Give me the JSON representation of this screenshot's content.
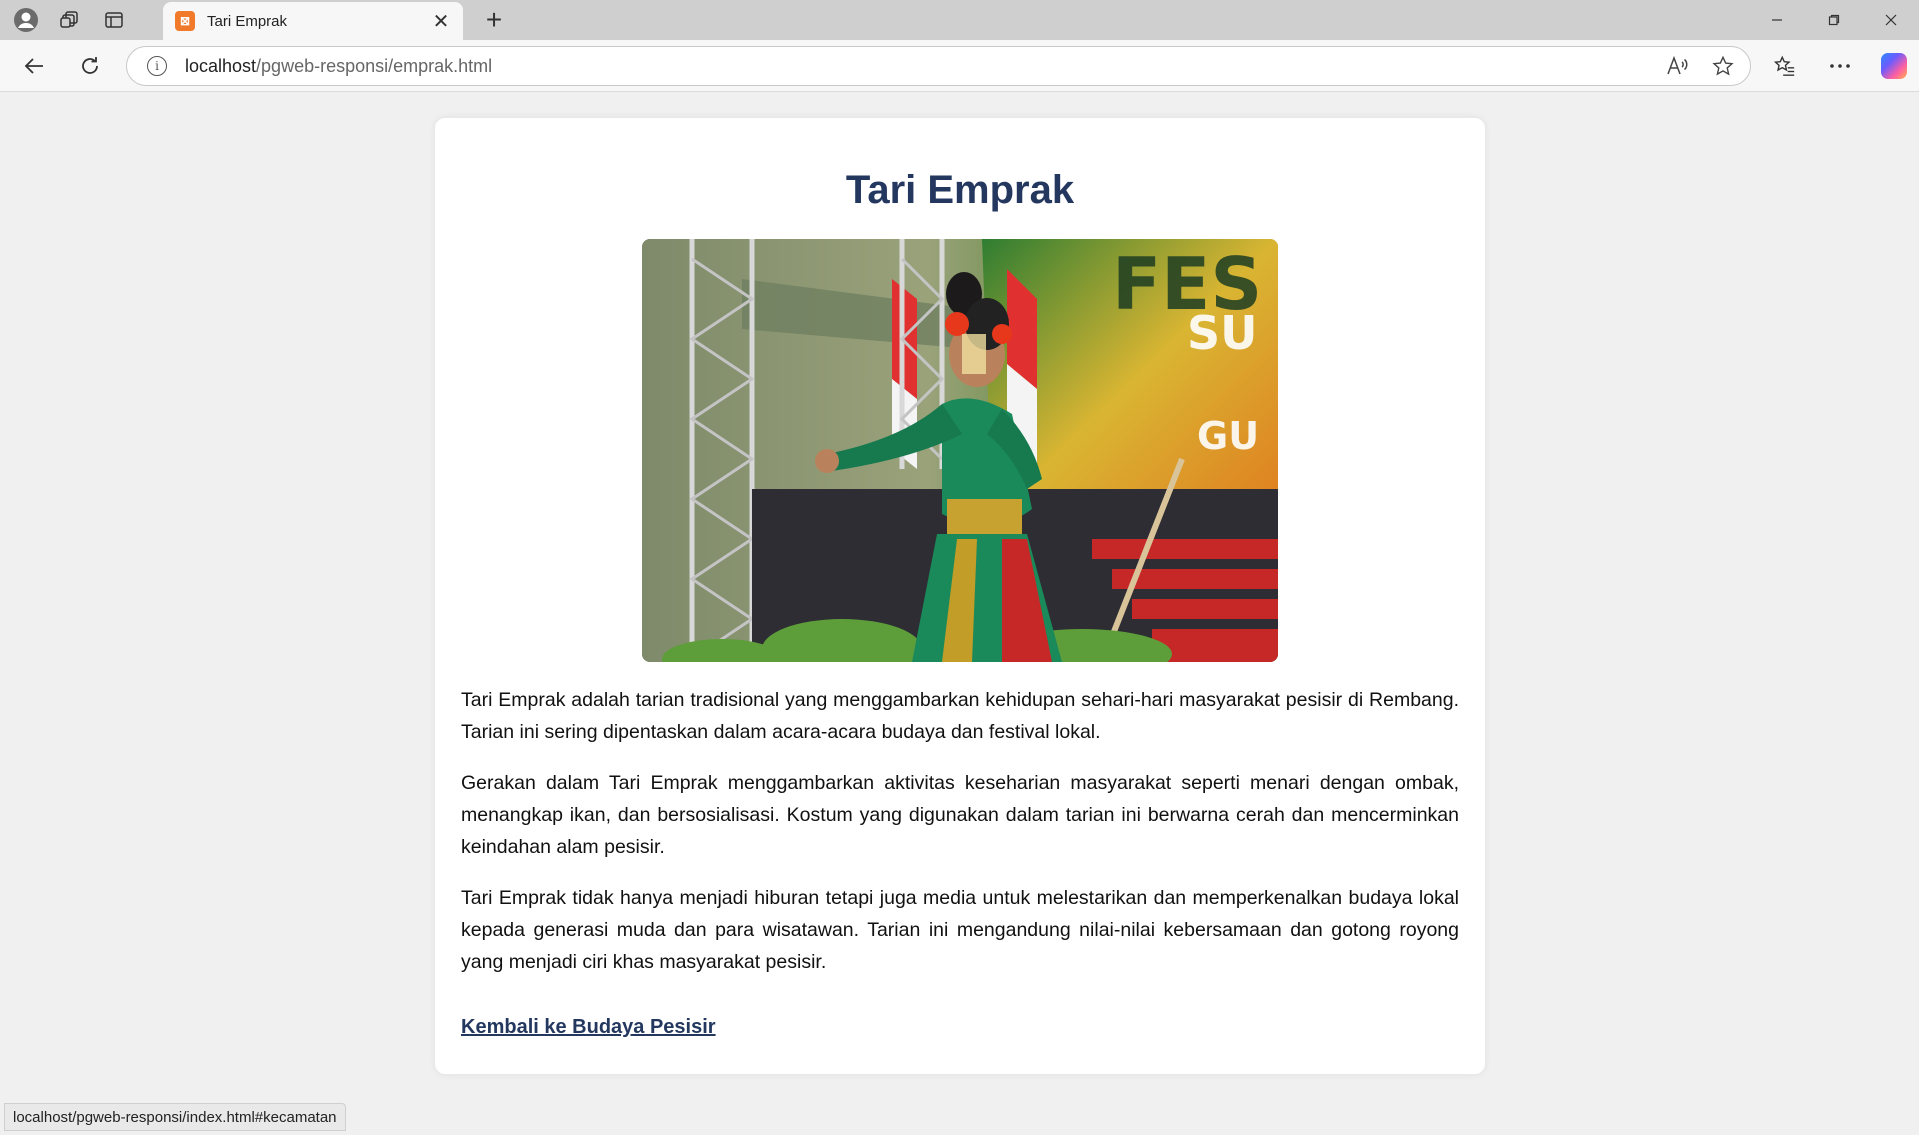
{
  "browser": {
    "tab_title": "Tari Emprak",
    "tab_favicon": "xampp-icon",
    "url_host": "localhost",
    "url_path": "/pgweb-responsi/emprak.html",
    "status_url": "localhost/pgweb-responsi/index.html#kecamatan"
  },
  "page": {
    "title": "Tari Emprak",
    "image_alt": "Penari Tari Emprak",
    "paragraphs": [
      "Tari Emprak adalah tarian tradisional yang menggambarkan kehidupan sehari-hari masyarakat pesisir di Rembang. Tarian ini sering dipentaskan dalam acara-acara budaya dan festival lokal.",
      "Gerakan dalam Tari Emprak menggambarkan aktivitas keseharian masyarakat seperti menari dengan ombak, menangkap ikan, dan bersosialisasi. Kostum yang digunakan dalam tarian ini berwarna cerah dan mencerminkan keindahan alam pesisir.",
      "Tari Emprak tidak hanya menjadi hiburan tetapi juga media untuk melestarikan dan memperkenalkan budaya lokal kepada generasi muda dan para wisatawan. Tarian ini mengandung nilai-nilai kebersamaan dan gotong royong yang menjadi ciri khas masyarakat pesisir."
    ],
    "back_link": "Kembali ke Budaya Pesisir"
  },
  "colors": {
    "title": "#23375f",
    "page_bg": "#f0f0f0",
    "card_bg": "#ffffff"
  }
}
